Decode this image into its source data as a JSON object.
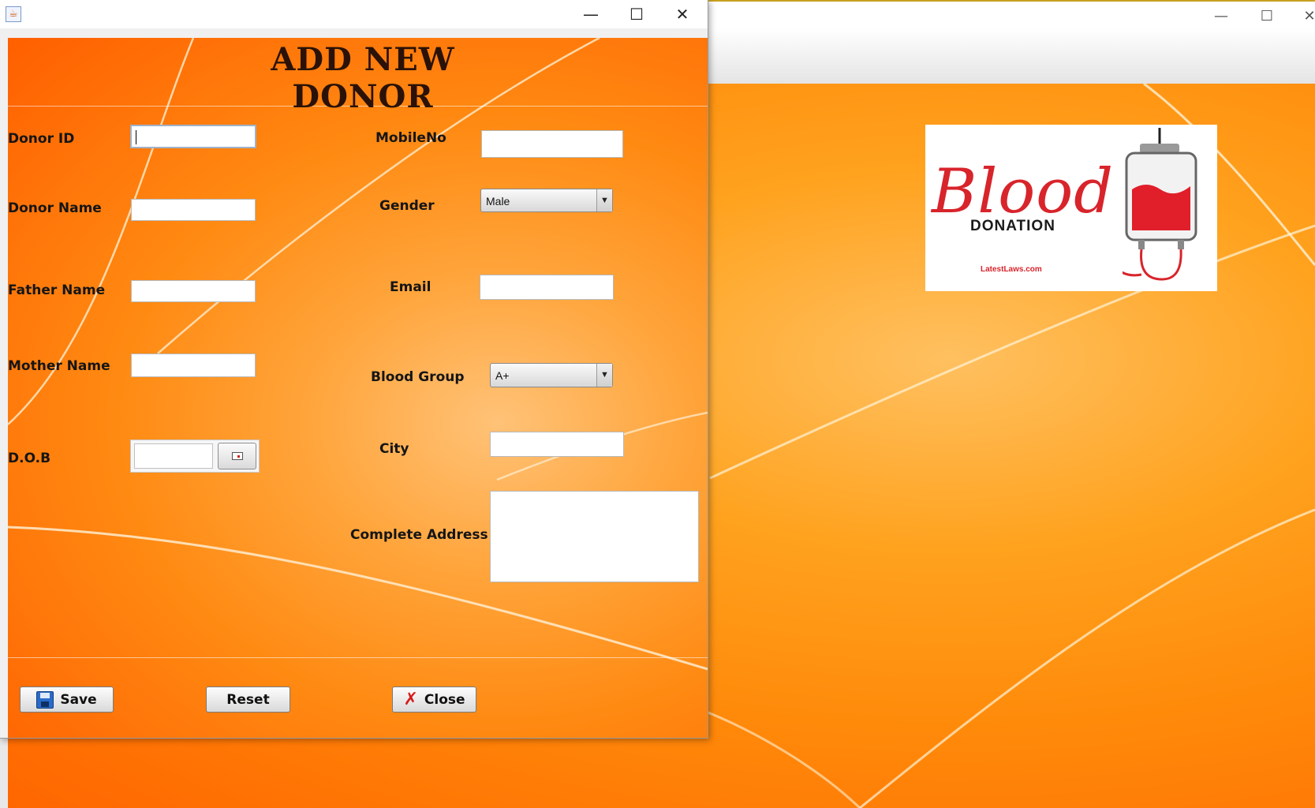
{
  "form": {
    "title": "ADD NEW DONOR",
    "labels": {
      "donor_id": "Donor ID",
      "donor_name": "Donor Name",
      "father_name": "Father Name",
      "mother_name": "Mother Name",
      "dob": "D.O.B",
      "mobile": "MobileNo",
      "gender": "Gender",
      "email": "Email",
      "blood_group": "Blood Group",
      "city": "City",
      "address": "Complete Address"
    },
    "values": {
      "donor_id": "",
      "donor_name": "",
      "father_name": "",
      "mother_name": "",
      "dob": "",
      "mobile": "",
      "email": "",
      "city": "",
      "address": ""
    },
    "gender_selected": "Male",
    "blood_group_selected": "A+",
    "buttons": {
      "save": "Save",
      "reset": "Reset",
      "close": "Close"
    }
  },
  "dialog_window": {
    "controls": {
      "minimize": "—",
      "maximize": "☐",
      "close": "✕"
    }
  },
  "background_window": {
    "controls": {
      "minimize": "—",
      "maximize": "☐",
      "close": "✕"
    },
    "logo": {
      "script_text": "Blood",
      "subtitle": "DONATION",
      "site": "LatestLaws.com"
    }
  },
  "colors": {
    "accent_orange": "#ff8a0a",
    "logo_red": "#d8242b",
    "title_brown": "#2a1208"
  },
  "icons": {
    "save": "floppy-disk-icon",
    "close": "red-x-icon",
    "dob_picker": "calendar-icon",
    "app": "java-app-icon"
  }
}
